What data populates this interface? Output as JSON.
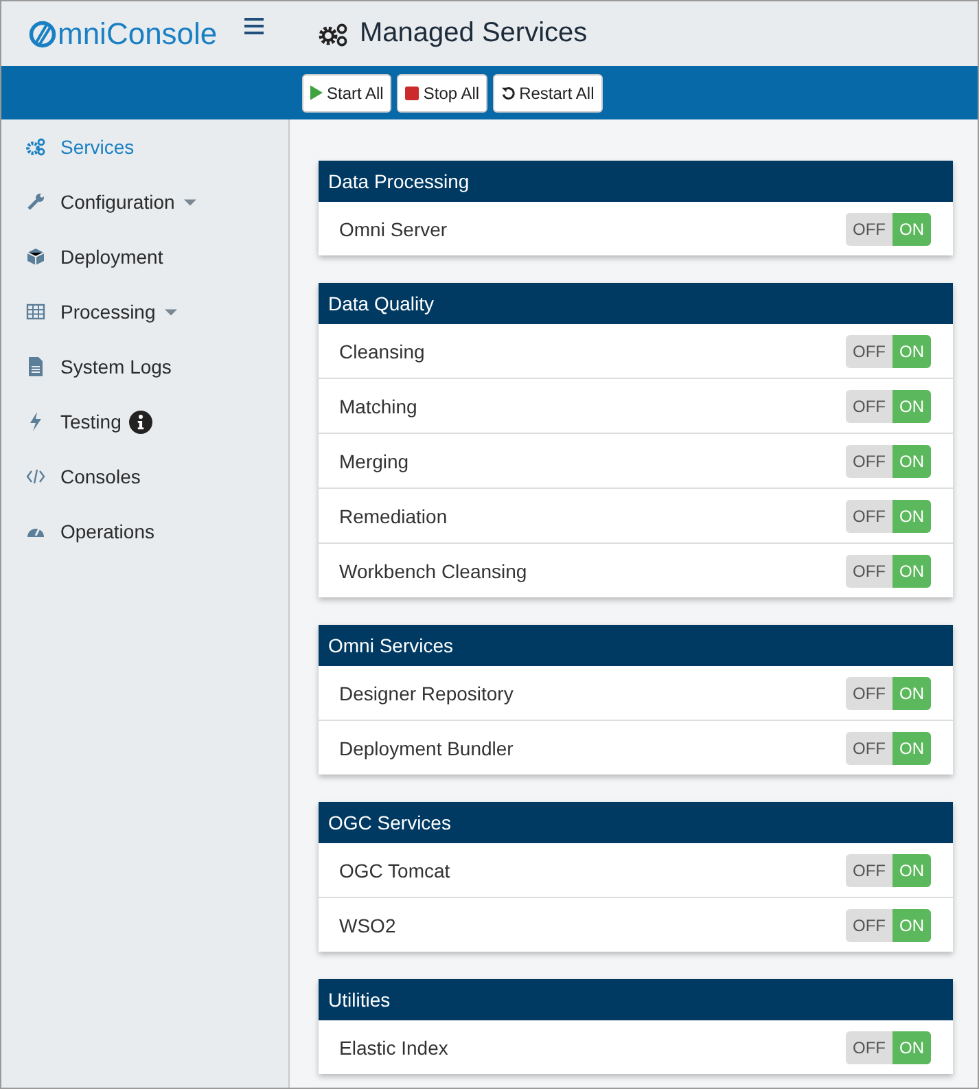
{
  "header": {
    "logo_text": "mniConsole",
    "page_title": "Managed Services"
  },
  "toolbar": {
    "buttons": [
      {
        "kind": "start",
        "label": "Start All"
      },
      {
        "kind": "stop",
        "label": "Stop All"
      },
      {
        "kind": "restart",
        "label": "Restart All"
      }
    ]
  },
  "sidebar": {
    "items": [
      {
        "label": "Services",
        "selected": true,
        "has_submenu": false,
        "info_badge": false
      },
      {
        "label": "Configuration",
        "selected": false,
        "has_submenu": true,
        "info_badge": false
      },
      {
        "label": "Deployment",
        "selected": false,
        "has_submenu": false,
        "info_badge": false
      },
      {
        "label": "Processing",
        "selected": false,
        "has_submenu": true,
        "info_badge": false
      },
      {
        "label": "System Logs",
        "selected": false,
        "has_submenu": false,
        "info_badge": false
      },
      {
        "label": "Testing",
        "selected": false,
        "has_submenu": false,
        "info_badge": true
      },
      {
        "label": "Consoles",
        "selected": false,
        "has_submenu": false,
        "info_badge": false
      },
      {
        "label": "Operations",
        "selected": false,
        "has_submenu": false,
        "info_badge": false
      }
    ]
  },
  "groups": [
    {
      "title": "Data Processing",
      "services": [
        {
          "name": "Omni Server",
          "on": true,
          "off_label": "OFF",
          "on_label": "ON"
        }
      ]
    },
    {
      "title": "Data Quality",
      "services": [
        {
          "name": "Cleansing",
          "on": true,
          "off_label": "OFF",
          "on_label": "ON"
        },
        {
          "name": "Matching",
          "on": true,
          "off_label": "OFF",
          "on_label": "ON"
        },
        {
          "name": "Merging",
          "on": true,
          "off_label": "OFF",
          "on_label": "ON"
        },
        {
          "name": "Remediation",
          "on": true,
          "off_label": "OFF",
          "on_label": "ON"
        },
        {
          "name": "Workbench Cleansing",
          "on": true,
          "off_label": "OFF",
          "on_label": "ON"
        }
      ]
    },
    {
      "title": "Omni Services",
      "services": [
        {
          "name": "Designer Repository",
          "on": true,
          "off_label": "OFF",
          "on_label": "ON"
        },
        {
          "name": "Deployment Bundler",
          "on": true,
          "off_label": "OFF",
          "on_label": "ON"
        }
      ]
    },
    {
      "title": "OGC Services",
      "services": [
        {
          "name": "OGC Tomcat",
          "on": true,
          "off_label": "OFF",
          "on_label": "ON"
        },
        {
          "name": "WSO2",
          "on": true,
          "off_label": "OFF",
          "on_label": "ON"
        }
      ]
    },
    {
      "title": "Utilities",
      "services": [
        {
          "name": "Elastic Index",
          "on": true,
          "off_label": "OFF",
          "on_label": "ON"
        }
      ]
    }
  ]
}
